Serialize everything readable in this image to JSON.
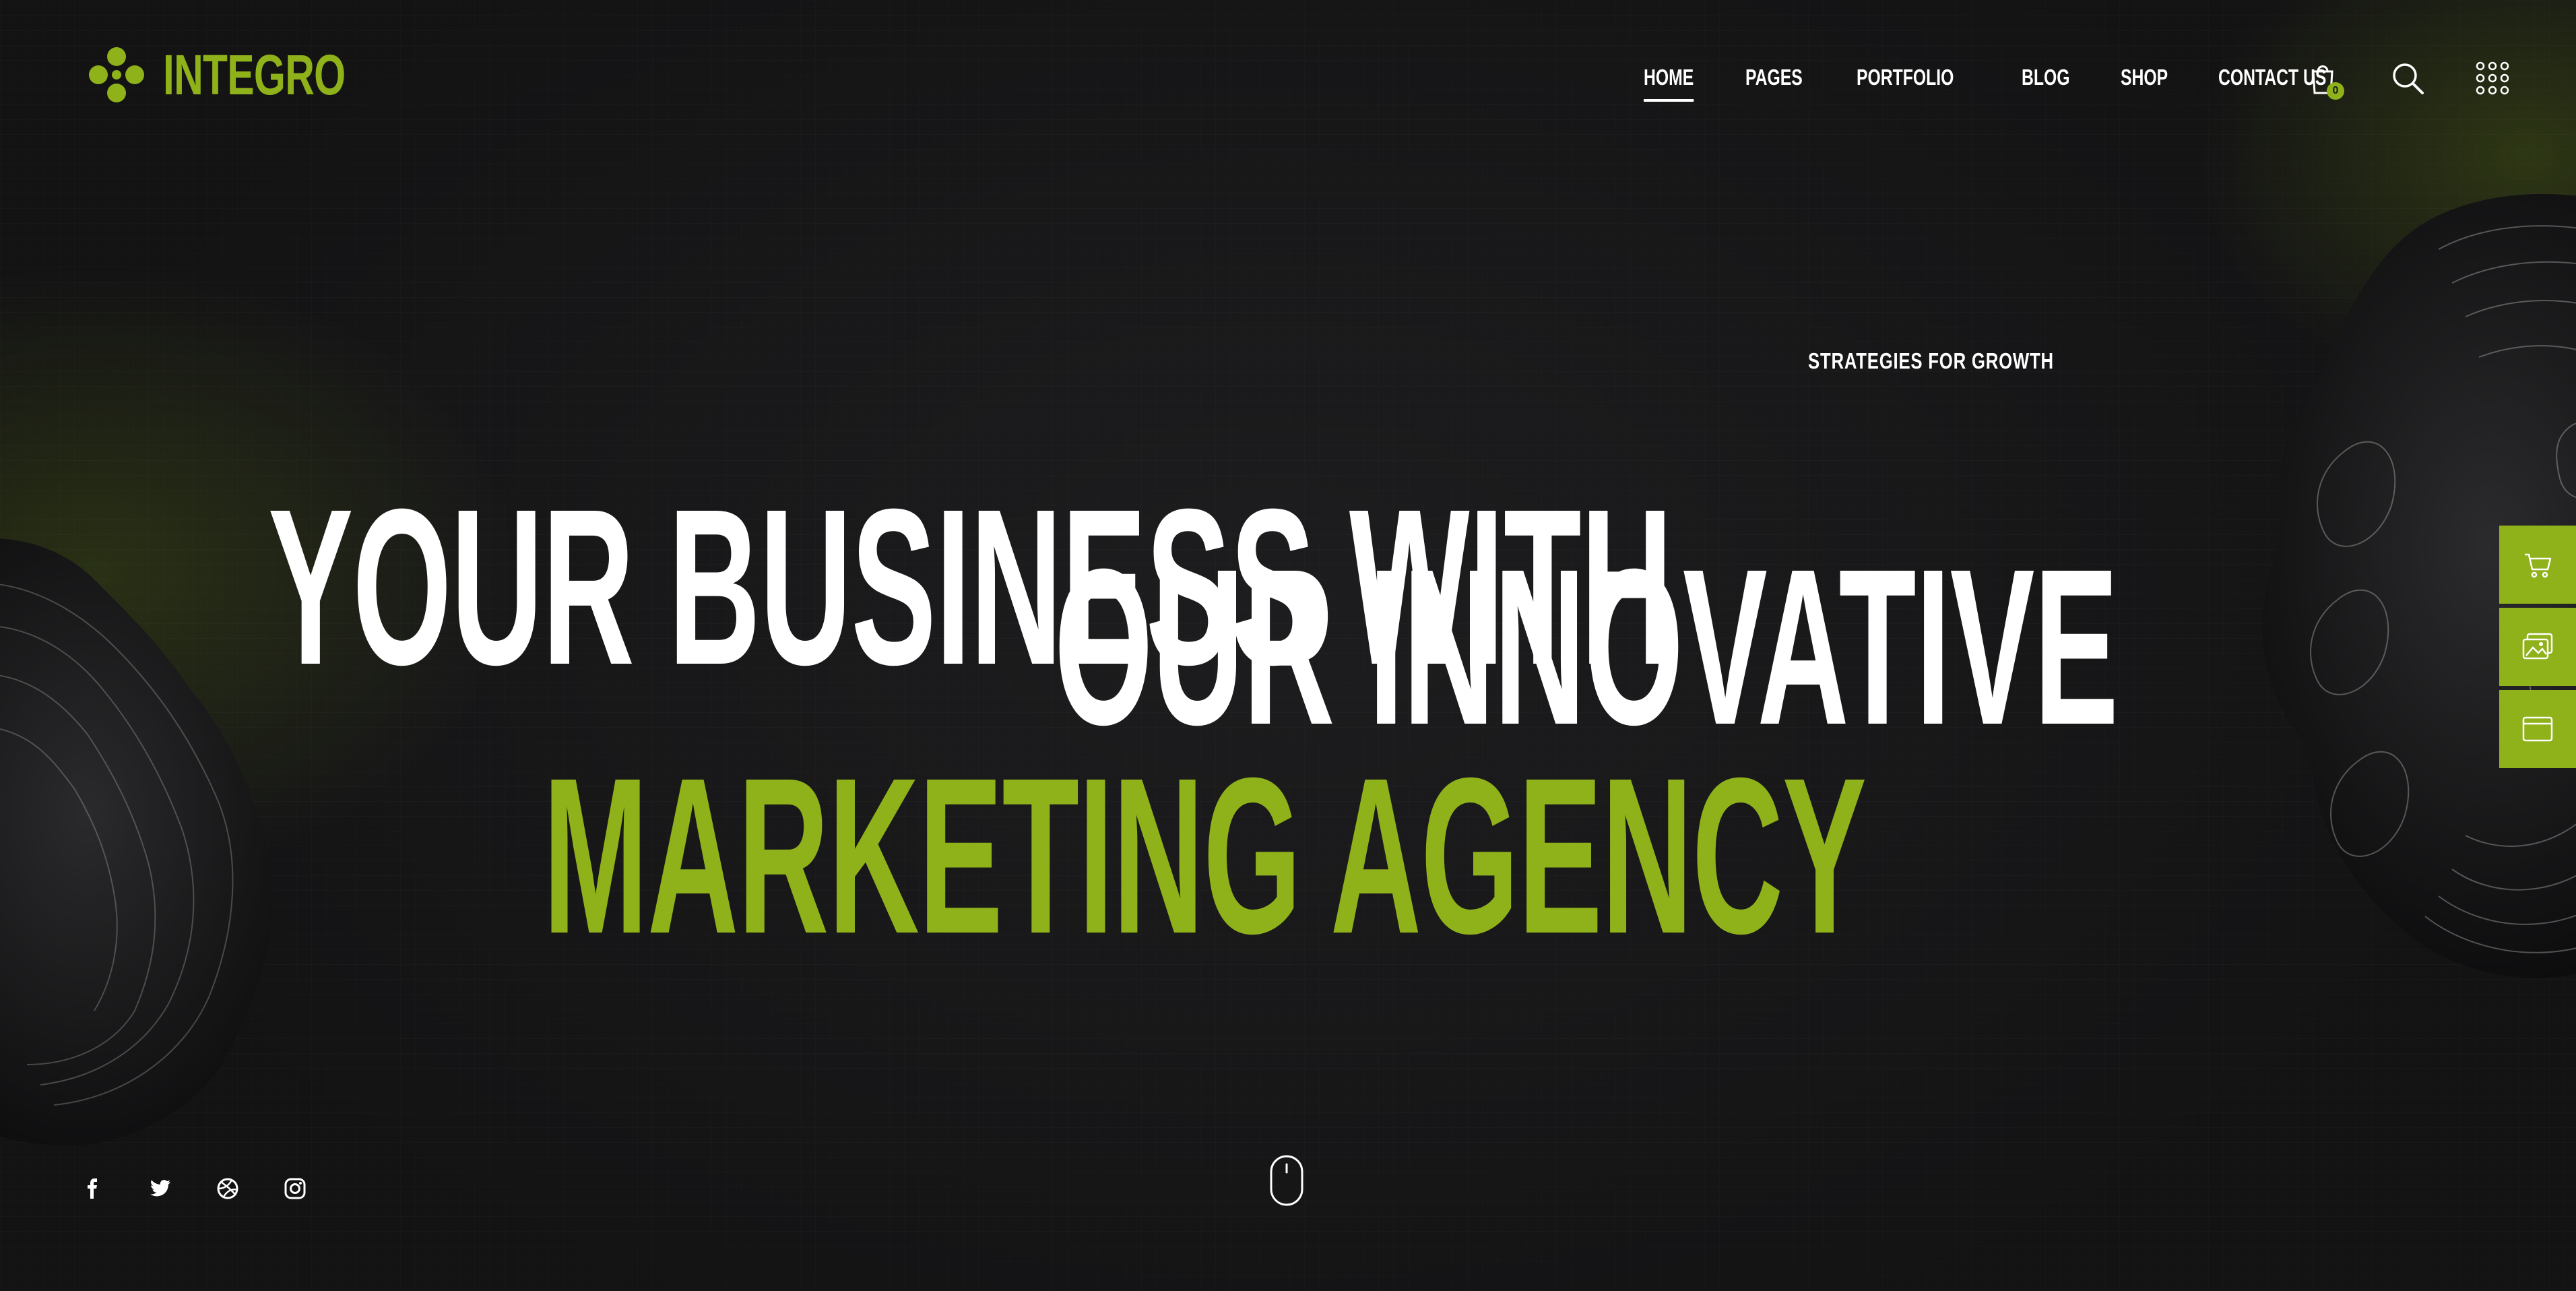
{
  "brand": {
    "name": "INTEGRO",
    "accent_color": "#8fb11a"
  },
  "nav": {
    "items": [
      {
        "label": "HOME",
        "active": true
      },
      {
        "label": "PAGES",
        "active": false
      },
      {
        "label": "PORTFOLIO",
        "active": false
      },
      {
        "label": "BLOG",
        "active": false
      },
      {
        "label": "SHOP",
        "active": false
      },
      {
        "label": "CONTACT US",
        "active": false
      }
    ]
  },
  "header_actions": {
    "cart_icon": "shopping-bag-icon",
    "cart_count": "0",
    "search_icon": "search-icon",
    "menu_icon": "grid-menu-icon"
  },
  "hero": {
    "line1": "YOUR BUSINESS WITH",
    "line2": "OUR INNOVATIVE",
    "line3": "MARKETING AGENCY",
    "tagline": "STRATEGIES FOR GROWTH"
  },
  "side_panel": {
    "buttons": [
      {
        "icon": "cart-icon"
      },
      {
        "icon": "images-icon"
      },
      {
        "icon": "browser-window-icon"
      }
    ]
  },
  "social": {
    "icons": [
      "facebook-icon",
      "twitter-icon",
      "dribbble-icon",
      "instagram-icon"
    ]
  },
  "scroll_indicator": {
    "icon": "mouse-scroll-icon"
  }
}
